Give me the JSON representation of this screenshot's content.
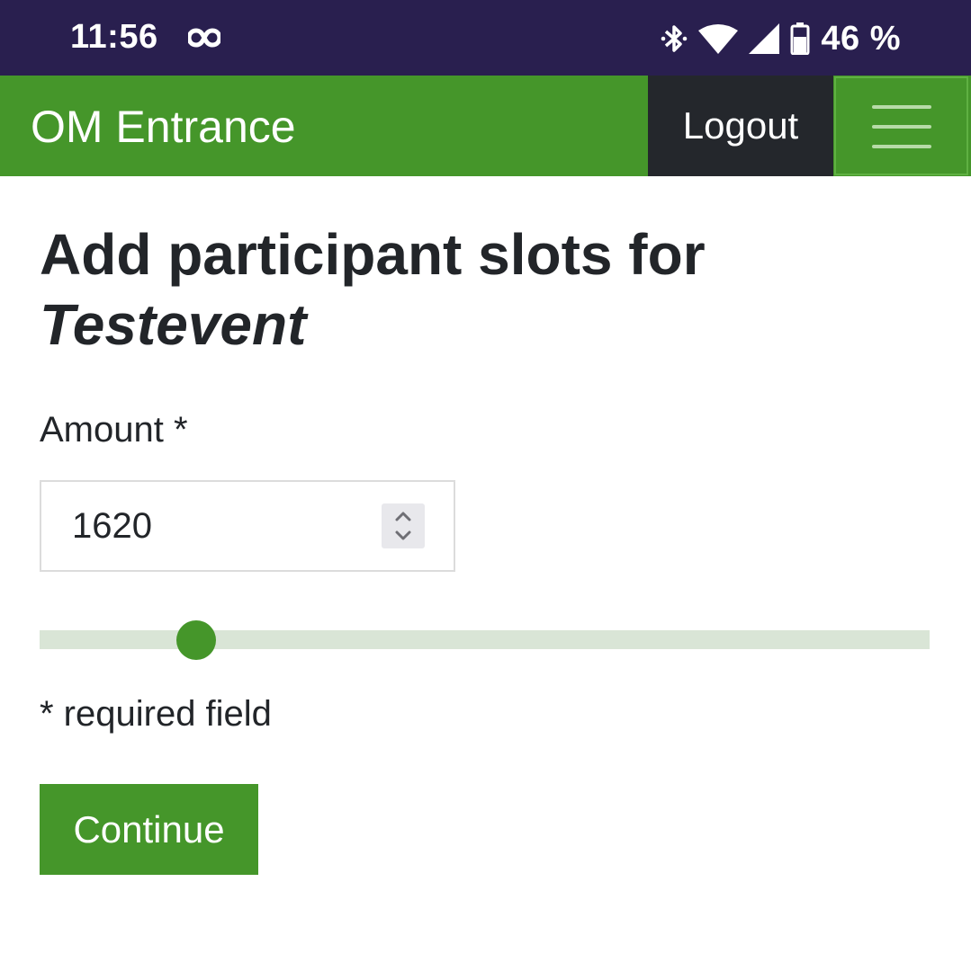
{
  "status_bar": {
    "time": "11:56",
    "battery_text": "46 %",
    "icons": [
      "infinity-icon",
      "bluetooth-icon",
      "wifi-icon",
      "cellular-signal-icon",
      "battery-icon"
    ],
    "background_color": "#291f4f"
  },
  "navbar": {
    "brand": "OM Entrance",
    "logout_label": "Logout",
    "menu_icon": "hamburger-menu-icon",
    "background_color": "#45962a",
    "logout_background_color": "#24272c"
  },
  "main": {
    "title_prefix": "Add participant slots for",
    "event_name": "Testevent",
    "amount_label": "Amount *",
    "amount_value": "1620",
    "slider_level": 0.176,
    "required_note": "* required field",
    "continue_label": "Continue",
    "accent_color": "#45962a"
  }
}
